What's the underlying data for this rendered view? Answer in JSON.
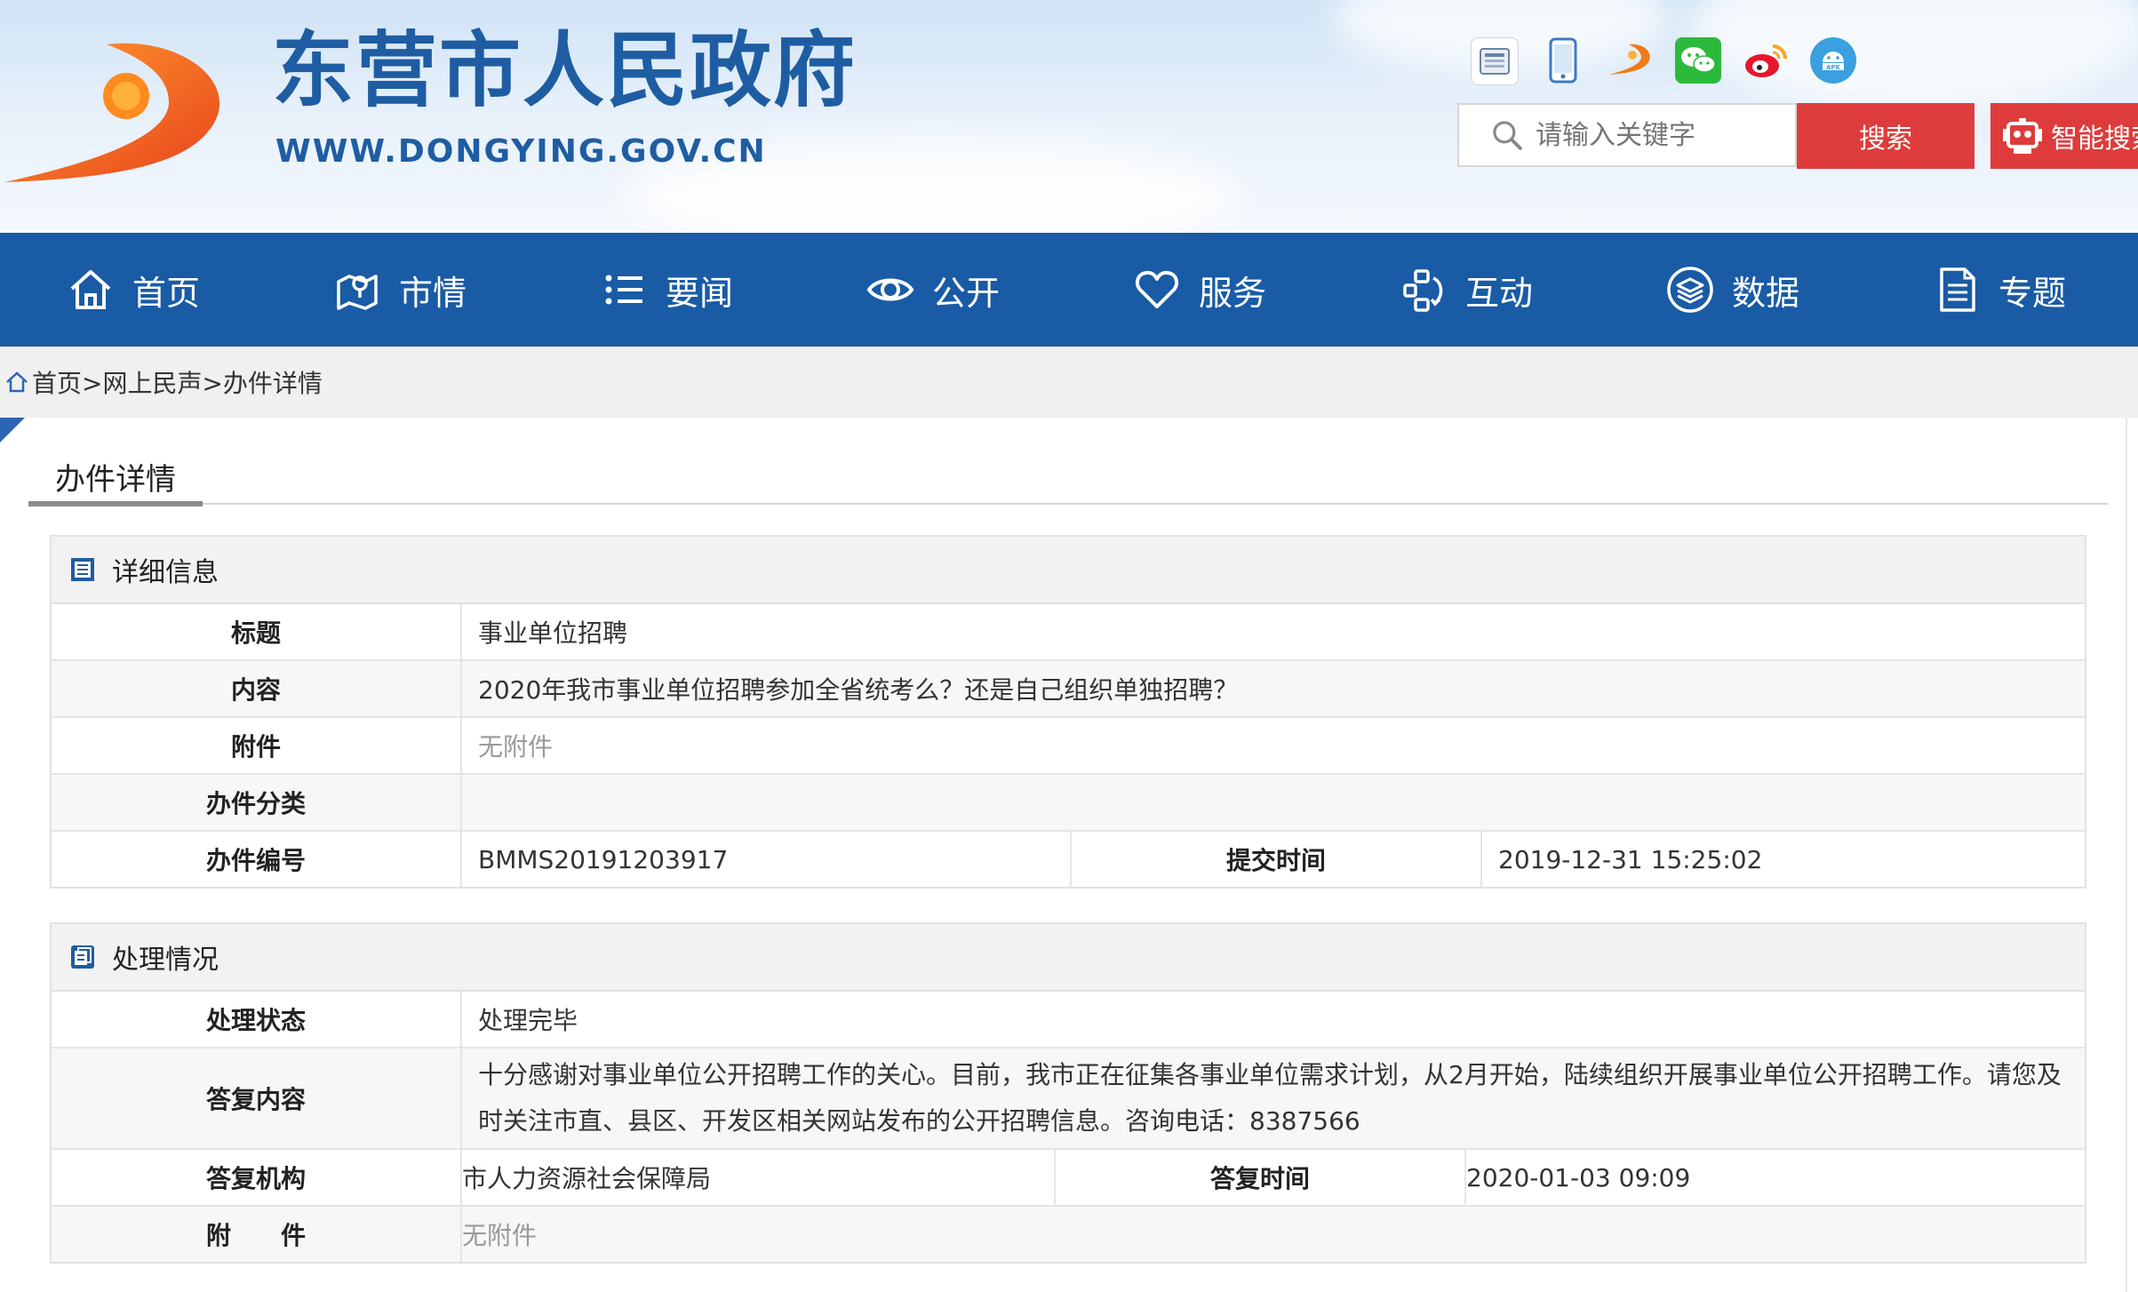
{
  "header": {
    "site_name": "东营市人民政府",
    "site_url": "WWW.DONGYING.GOV.CN",
    "share_icons": [
      {
        "name": "service-hall-icon",
        "label": "服务厅",
        "color": "#6a84a8"
      },
      {
        "name": "mobile-icon",
        "label": "",
        "color": "#3c79c6"
      },
      {
        "name": "logo-small-icon",
        "label": "",
        "color": "#f07a1a"
      },
      {
        "name": "wechat-icon",
        "label": "",
        "color": "#2dba3c"
      },
      {
        "name": "weibo-icon",
        "label": "",
        "color": "#e6162d"
      },
      {
        "name": "apk-icon",
        "label": "APK",
        "color": "#3aa0e0"
      }
    ],
    "search": {
      "placeholder": "请输入关键字",
      "button_label": "搜索",
      "smart_label": "智能搜索"
    }
  },
  "nav": {
    "items": [
      {
        "label": "首页",
        "icon": "home-icon"
      },
      {
        "label": "市情",
        "icon": "map-icon"
      },
      {
        "label": "要闻",
        "icon": "list-icon"
      },
      {
        "label": "公开",
        "icon": "eye-icon"
      },
      {
        "label": "服务",
        "icon": "heart-icon"
      },
      {
        "label": "互动",
        "icon": "interact-icon"
      },
      {
        "label": "数据",
        "icon": "layers-icon"
      },
      {
        "label": "专题",
        "icon": "document-icon"
      }
    ]
  },
  "breadcrumb": {
    "text": "首页>网上民声>办件详情"
  },
  "page": {
    "title": "办件详情"
  },
  "details": {
    "heading": "详细信息",
    "title_label": "标题",
    "title_value": "事业单位招聘",
    "content_label": "内容",
    "content_value": "2020年我市事业单位招聘参加全省统考么？还是自己组织单独招聘？",
    "attachment_label": "附件",
    "attachment_value": "无附件",
    "category_label": "办件分类",
    "category_value": "",
    "number_label": "办件编号",
    "number_value": "BMMS20191203917",
    "submit_time_label": "提交时间",
    "submit_time_value": "2019-12-31 15:25:02"
  },
  "processing": {
    "heading": "处理情况",
    "status_label": "处理状态",
    "status_value": "处理完毕",
    "reply_label": "答复内容",
    "reply_value": "十分感谢对事业单位公开招聘工作的关心。目前，我市正在征集各事业单位需求计划，从2月开始，陆续组织开展事业单位公开招聘工作。请您及时关注市直、县区、开发区相关网站发布的公开招聘信息。咨询电话：8387566",
    "org_label": "答复机构",
    "org_value": "市人力资源社会保障局",
    "reply_time_label": "答复时间",
    "reply_time_value": "2020-01-03 09:09",
    "attachment_label": "附　　件",
    "attachment_value": "无附件"
  },
  "colors": {
    "nav_bg": "#195ba5",
    "brand_blue": "#1f5da3",
    "search_red": "#de3c3c"
  }
}
